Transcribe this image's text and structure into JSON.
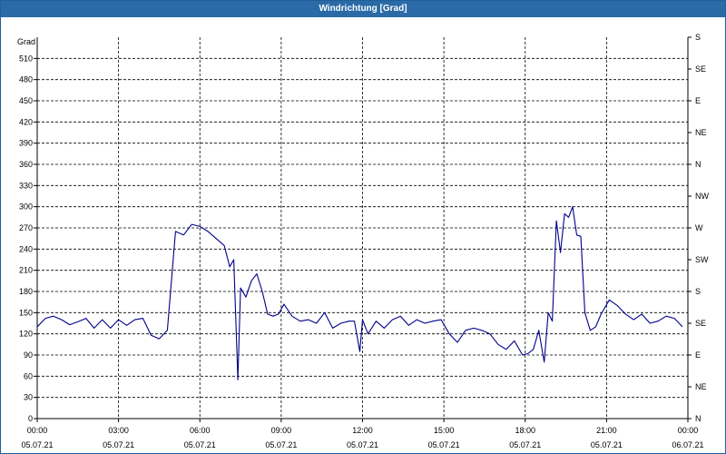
{
  "window": {
    "title": "Windrichtung [Grad]"
  },
  "chart_data": {
    "type": "line",
    "title": "Windrichtung [Grad]",
    "ylabel": "Grad",
    "ylim": [
      0,
      540
    ],
    "yticks": [
      0,
      30,
      60,
      90,
      120,
      150,
      180,
      210,
      240,
      270,
      300,
      330,
      360,
      390,
      420,
      450,
      480,
      510
    ],
    "right_axis_labels": [
      "N",
      "NE",
      "E",
      "SE",
      "S",
      "SW",
      "W",
      "NW",
      "N",
      "NE",
      "E",
      "SE",
      "S"
    ],
    "x_hours_range": [
      0,
      24
    ],
    "xticks": [
      {
        "hour": 0,
        "time": "00:00",
        "date": "05.07.21"
      },
      {
        "hour": 3,
        "time": "03:00",
        "date": "05.07.21"
      },
      {
        "hour": 6,
        "time": "06:00",
        "date": "05.07.21"
      },
      {
        "hour": 9,
        "time": "09:00",
        "date": "05.07.21"
      },
      {
        "hour": 12,
        "time": "12:00",
        "date": "05.07.21"
      },
      {
        "hour": 15,
        "time": "15:00",
        "date": "05.07.21"
      },
      {
        "hour": 18,
        "time": "18:00",
        "date": "05.07.21"
      },
      {
        "hour": 21,
        "time": "21:00",
        "date": "05.07.21"
      },
      {
        "hour": 24,
        "time": "00:00",
        "date": "06.07.21"
      }
    ],
    "grid": true,
    "line_color": "#00008b",
    "series": [
      {
        "x": [
          0,
          0.3,
          0.6,
          0.9,
          1.2,
          1.5,
          1.8,
          2.1,
          2.4,
          2.7,
          3.0,
          3.3,
          3.6,
          3.9,
          4.2,
          4.5,
          4.8,
          5.1,
          5.4,
          5.7,
          6.0,
          6.3,
          6.6,
          6.9,
          7.1,
          7.25,
          7.4,
          7.5,
          7.7,
          7.9,
          8.1,
          8.3,
          8.5,
          8.7,
          8.9,
          9.1,
          9.4,
          9.7,
          10.0,
          10.3,
          10.6,
          10.9,
          11.2,
          11.5,
          11.7,
          11.9,
          12.0,
          12.2,
          12.5,
          12.8,
          13.1,
          13.4,
          13.7,
          14.0,
          14.3,
          14.6,
          14.9,
          15.2,
          15.5,
          15.8,
          16.1,
          16.4,
          16.7,
          17.0,
          17.3,
          17.6,
          17.9,
          18.1,
          18.3,
          18.5,
          18.7,
          18.85,
          19.0,
          19.15,
          19.3,
          19.45,
          19.6,
          19.75,
          19.9,
          20.05,
          20.2,
          20.4,
          20.6,
          20.8,
          21.1,
          21.4,
          21.7,
          22.0,
          22.3,
          22.6,
          22.9,
          23.2,
          23.5,
          23.8
        ],
        "y": [
          130,
          142,
          145,
          140,
          133,
          137,
          142,
          128,
          140,
          128,
          140,
          132,
          140,
          142,
          118,
          113,
          125,
          265,
          260,
          275,
          272,
          265,
          255,
          245,
          215,
          225,
          55,
          185,
          172,
          195,
          205,
          180,
          148,
          145,
          148,
          162,
          145,
          138,
          140,
          135,
          150,
          128,
          135,
          138,
          138,
          95,
          140,
          120,
          138,
          128,
          140,
          145,
          132,
          140,
          135,
          138,
          140,
          120,
          108,
          125,
          128,
          125,
          120,
          105,
          98,
          110,
          90,
          92,
          98,
          125,
          80,
          150,
          138,
          280,
          235,
          290,
          285,
          300,
          260,
          258,
          150,
          125,
          130,
          148,
          168,
          160,
          148,
          140,
          148,
          135,
          138,
          145,
          142,
          130
        ]
      }
    ]
  }
}
